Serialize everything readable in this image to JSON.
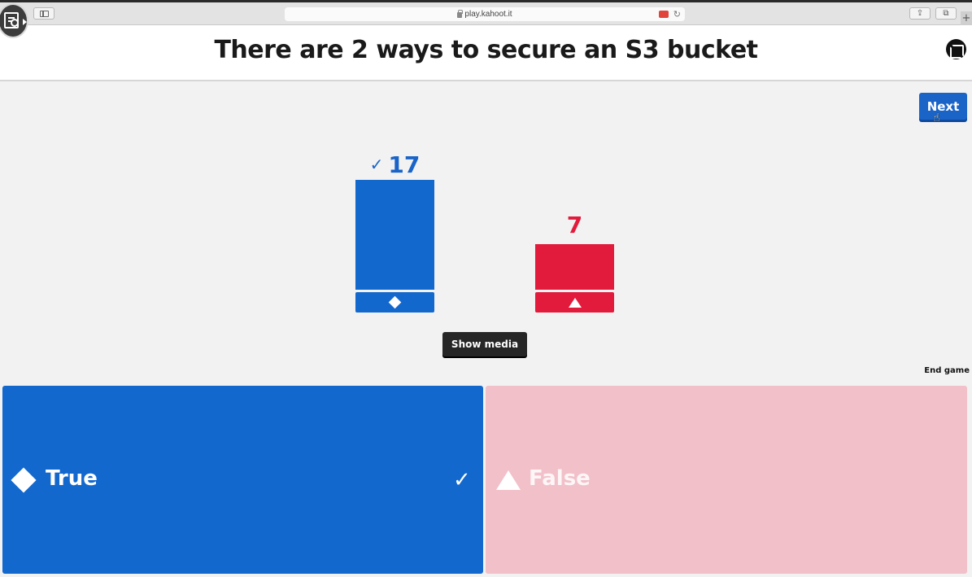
{
  "browser": {
    "url": "play.kahoot.it",
    "new_tab": "+"
  },
  "question": {
    "title": "There are 2 ways to secure an S3 bucket"
  },
  "controls": {
    "next_label": "Next",
    "show_media_label": "Show media",
    "end_game_label": "End game"
  },
  "chart_data": {
    "type": "bar",
    "categories": [
      "True",
      "False"
    ],
    "values": [
      17,
      7
    ],
    "correct": [
      true,
      false
    ],
    "colors": [
      "#1368ce",
      "#e21b3c"
    ],
    "shapes": [
      "diamond",
      "triangle"
    ]
  },
  "results": {
    "true_count": "17",
    "false_count": "7",
    "check_mark": "✓"
  },
  "answers": [
    {
      "label": "True",
      "shape": "diamond-icon",
      "color": "#1368ce",
      "correct": true
    },
    {
      "label": "False",
      "shape": "triangle-icon",
      "color": "#f2c0c9",
      "correct": false
    }
  ],
  "icons": {
    "answer_check": "✓",
    "reload": "↻",
    "share": "⇪",
    "tabs": "⧉"
  }
}
